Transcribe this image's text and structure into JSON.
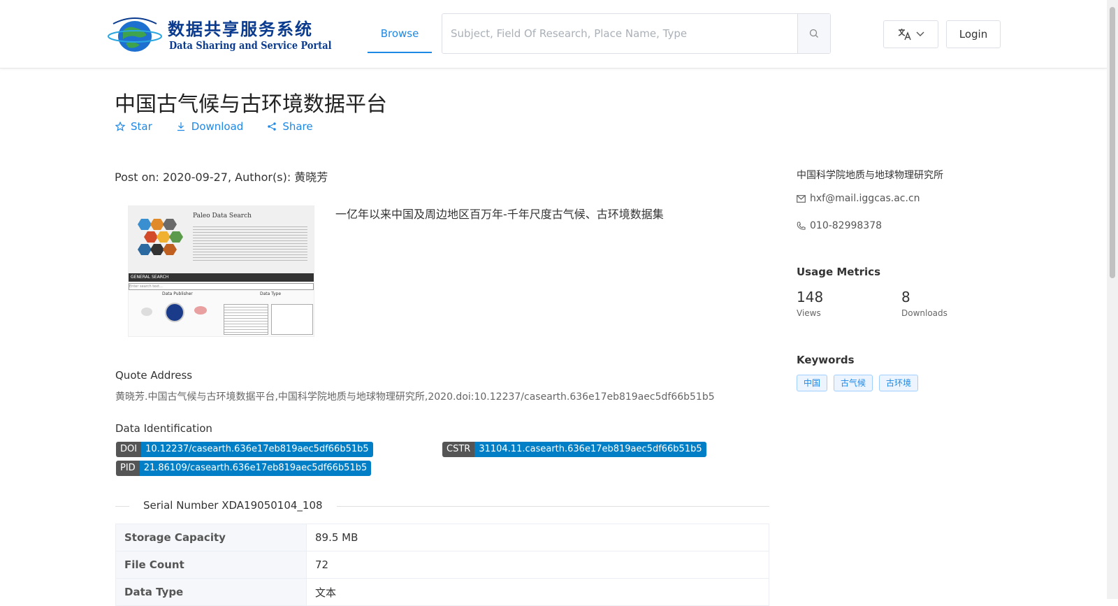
{
  "header": {
    "logo_cn": "数据共享服务系统",
    "logo_en": "Data Sharing and Service Portal",
    "nav_browse": "Browse",
    "search_placeholder": "Subject, Field Of Research, Place Name, Type",
    "login": "Login"
  },
  "dataset": {
    "title": "中国古气候与古环境数据平台",
    "actions": {
      "star": "Star",
      "download": "Download",
      "share": "Share"
    },
    "meta": "Post on: 2020-09-27, Author(s): 黄晓芳",
    "description": "一亿年以来中国及周边地区百万年-千年尺度古气候、古环境数据集",
    "thumbnail": {
      "title": "Paleo Data Search",
      "bar": "GENERAL SEARCH",
      "placeholder": "Enter search text...",
      "col1": "Data Publisher",
      "col2": "Data Type"
    },
    "quote_label": "Quote Address",
    "quote": "黄晓芳.中国古气候与古环境数据平台,中国科学院地质与地球物理研究所,2020.doi:10.12237/casearth.636e17eb819aec5df66b51b5",
    "identification_label": "Data Identification",
    "ids": [
      {
        "key": "DOI",
        "value": "10.12237/casearth.636e17eb819aec5df66b51b5"
      },
      {
        "key": "CSTR",
        "value": "31104.11.casearth.636e17eb819aec5df66b51b5"
      },
      {
        "key": "PID",
        "value": "21.86109/casearth.636e17eb819aec5df66b51b5"
      }
    ],
    "serial": "Serial Number XDA19050104_108",
    "table": [
      {
        "key": "Storage Capacity",
        "value": "89.5 MB"
      },
      {
        "key": "File Count",
        "value": "72"
      },
      {
        "key": "Data Type",
        "value": "文本"
      }
    ]
  },
  "sidebar": {
    "org": "中国科学院地质与地球物理研究所",
    "email": "hxf@mail.iggcas.ac.cn",
    "phone": "010-82998378",
    "metrics_title": "Usage Metrics",
    "views": {
      "value": "148",
      "label": "Views"
    },
    "downloads": {
      "value": "8",
      "label": "Downloads"
    },
    "keywords_title": "Keywords",
    "keywords": [
      "中国",
      "古气候",
      "古环境"
    ]
  },
  "colors": {
    "accent": "#1e88e5",
    "badge_key": "#555555",
    "badge_value": "#007ec6"
  }
}
